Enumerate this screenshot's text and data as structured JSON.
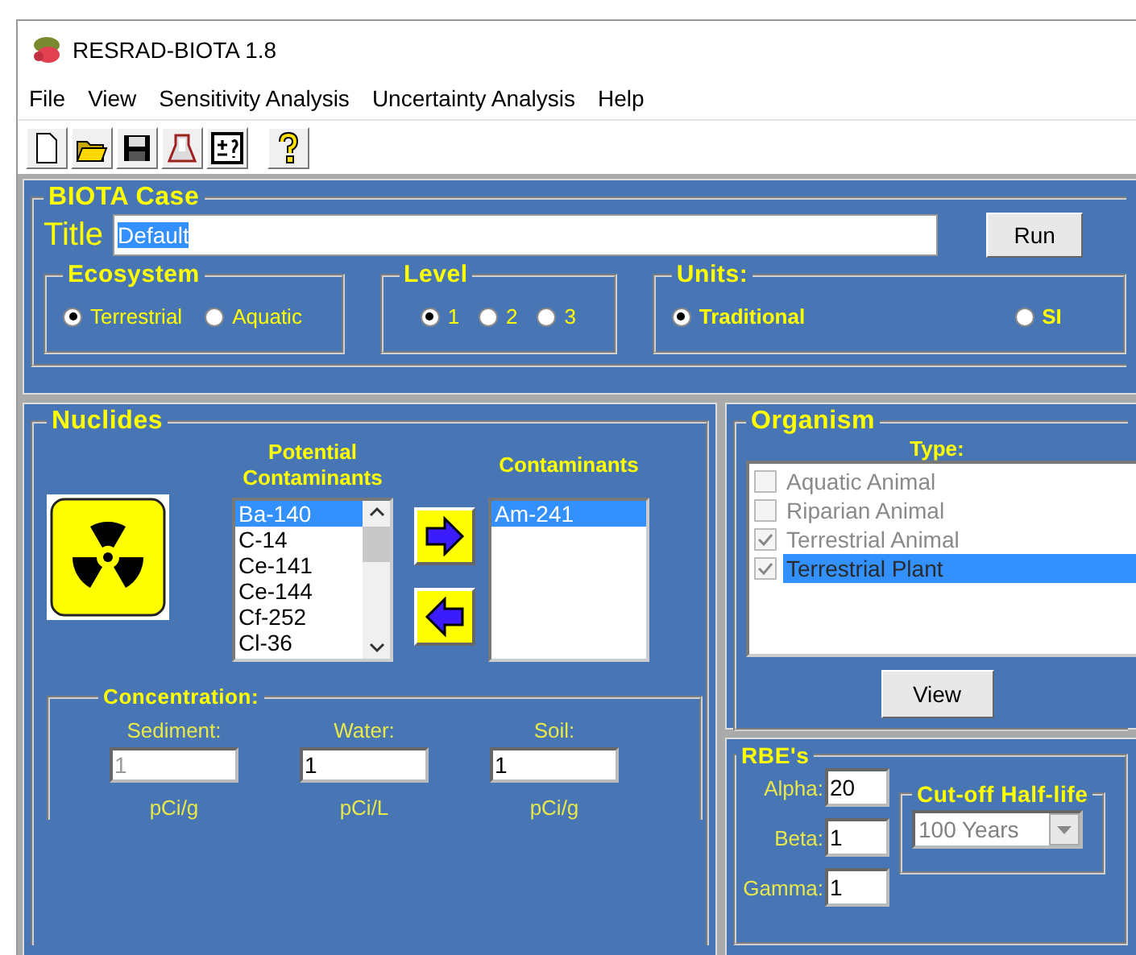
{
  "window": {
    "title": "RESRAD-BIOTA 1.8"
  },
  "menu": [
    "File",
    "View",
    "Sensitivity Analysis",
    "Uncertainty Analysis",
    "Help"
  ],
  "biota_case": {
    "heading": "BIOTA Case",
    "title_label": "Title",
    "title_value": "Default",
    "title_text_selected": true,
    "run_button": "Run",
    "ecosystem": {
      "heading": "Ecosystem",
      "options": [
        {
          "label": "Terrestrial",
          "selected": true
        },
        {
          "label": "Aquatic",
          "selected": false
        }
      ]
    },
    "level": {
      "heading": "Level",
      "options": [
        {
          "label": "1",
          "selected": true
        },
        {
          "label": "2",
          "selected": false
        },
        {
          "label": "3",
          "selected": false
        }
      ]
    },
    "units": {
      "heading": "Units:",
      "options": [
        {
          "label": "Traditional",
          "selected": true
        },
        {
          "label": "SI",
          "selected": false
        }
      ]
    }
  },
  "nuclides": {
    "heading": "Nuclides",
    "potential_heading": "Potential Contaminants",
    "potential": [
      {
        "label": "Ba-140",
        "selected": true
      },
      {
        "label": "C-14",
        "selected": false
      },
      {
        "label": "Ce-141",
        "selected": false
      },
      {
        "label": "Ce-144",
        "selected": false
      },
      {
        "label": "Cf-252",
        "selected": false
      },
      {
        "label": "Cl-36",
        "selected": false
      }
    ],
    "contaminants_heading": "Contaminants",
    "contaminants": [
      {
        "label": "Am-241",
        "selected": true
      }
    ],
    "concentration": {
      "heading": "Concentration:",
      "fields": [
        {
          "label": "Sediment:",
          "value": "1",
          "unit": "pCi/g",
          "disabled": true
        },
        {
          "label": "Water:",
          "value": "1",
          "unit": "pCi/L",
          "disabled": false
        },
        {
          "label": "Soil:",
          "value": "1",
          "unit": "pCi/g",
          "disabled": false
        }
      ]
    }
  },
  "organism": {
    "heading": "Organism",
    "type_label": "Type:",
    "disabled": true,
    "types": [
      {
        "label": "Aquatic Animal",
        "checked": false,
        "selected": false
      },
      {
        "label": "Riparian Animal",
        "checked": false,
        "selected": false
      },
      {
        "label": "Terrestrial Animal",
        "checked": true,
        "selected": false
      },
      {
        "label": "Terrestrial Plant",
        "checked": true,
        "selected": true
      }
    ],
    "view_button": "View"
  },
  "rbes": {
    "heading": "RBE's",
    "fields": [
      {
        "label": "Alpha:",
        "value": "20"
      },
      {
        "label": "Beta:",
        "value": "1"
      },
      {
        "label": "Gamma:",
        "value": "1"
      }
    ],
    "cutoff": {
      "heading": "Cut-off Half-life",
      "value": "100 Years"
    }
  }
}
